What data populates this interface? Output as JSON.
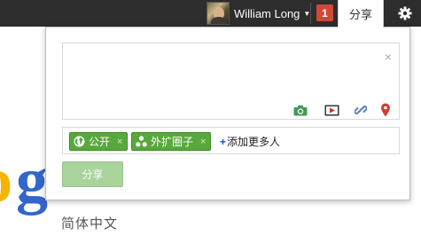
{
  "topbar": {
    "user_name": "William Long",
    "notification_count": "1",
    "share_tab_label": "分享"
  },
  "background": {
    "logo_partial": "og",
    "subtitle": "简体中文"
  },
  "share_box": {
    "compose_placeholder": "",
    "close_symbol": "×",
    "attachments": [
      "camera-icon",
      "video-icon",
      "link-icon",
      "map-pin-icon"
    ],
    "audience": {
      "chips": [
        {
          "label": "公开",
          "icon": "globe-icon",
          "remove": "×"
        },
        {
          "label": "外扩圈子",
          "icon": "circles-icon",
          "remove": "×"
        }
      ],
      "add_more_plus": "+",
      "add_more_label": "添加更多人"
    },
    "share_button_label": "分享"
  },
  "colors": {
    "topbar": "#2d2d2d",
    "notification": "#d14836",
    "chip_green": "#58a83c",
    "share_button_disabled": "#a8d39a",
    "link_blue": "#1155cc"
  }
}
